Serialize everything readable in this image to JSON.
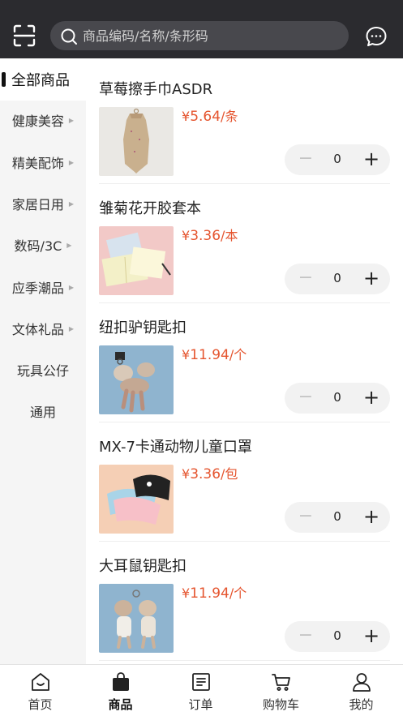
{
  "header": {
    "search_placeholder": "商品编码/名称/条形码",
    "scan_icon": "scan-icon",
    "message_icon": "chat-bubble-icon"
  },
  "sidebar": {
    "items": [
      {
        "label": "全部商品",
        "active": true
      },
      {
        "label": "健康美容",
        "has_arrow": true
      },
      {
        "label": "精美配饰",
        "has_arrow": true
      },
      {
        "label": "家居日用",
        "has_arrow": true
      },
      {
        "label": "数码/3C",
        "has_arrow": true
      },
      {
        "label": "应季潮品",
        "has_arrow": true
      },
      {
        "label": "文体礼品",
        "has_arrow": true
      },
      {
        "label": "玩具公仔",
        "has_arrow": false
      },
      {
        "label": "通用",
        "has_arrow": false
      }
    ]
  },
  "products": [
    {
      "name": "草莓擦手巾ASDR",
      "currency": "¥",
      "price": "5.64",
      "unit": "/条",
      "qty": "0"
    },
    {
      "name": "雏菊花开胶套本",
      "currency": "¥",
      "price": "3.36",
      "unit": "/本",
      "qty": "0"
    },
    {
      "name": "纽扣驴钥匙扣",
      "currency": "¥",
      "price": "11.94",
      "unit": "/个",
      "qty": "0"
    },
    {
      "name": "MX-7卡通动物儿童口罩",
      "currency": "¥",
      "price": "3.36",
      "unit": "/包",
      "qty": "0"
    },
    {
      "name": "大耳鼠钥匙扣",
      "currency": "¥",
      "price": "11.94",
      "unit": "/个",
      "qty": "0"
    }
  ],
  "stepper": {
    "minus": "−",
    "plus": "+"
  },
  "tabbar": {
    "tabs": [
      {
        "label": "首页",
        "icon": "home-icon"
      },
      {
        "label": "商品",
        "icon": "bag-icon",
        "active": true
      },
      {
        "label": "订单",
        "icon": "order-list-icon"
      },
      {
        "label": "购物车",
        "icon": "cart-icon"
      },
      {
        "label": "我的",
        "icon": "user-icon"
      }
    ]
  },
  "colors": {
    "accent_price": "#e5552f",
    "topbar": "#2b2b2f"
  }
}
